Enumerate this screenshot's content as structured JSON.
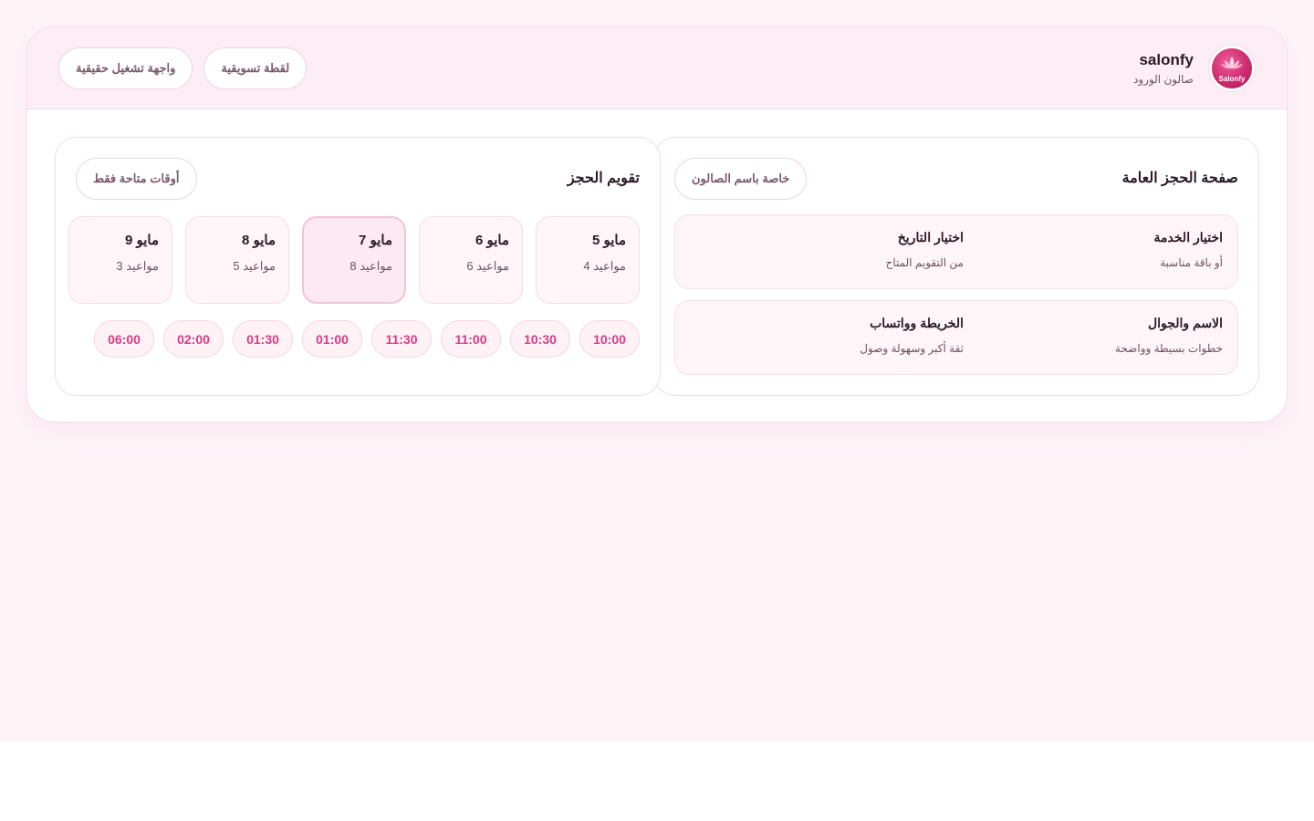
{
  "brand": {
    "name": "salonfy",
    "subtitle": "صالون الورود",
    "logo_text": "Salonfy",
    "logo_icon": "lotus-icon"
  },
  "header": {
    "pills": [
      "واجهة تشغيل حقيقية",
      "لقطة تسويقية"
    ]
  },
  "booking_page": {
    "title": "صفحة الحجز العامة",
    "badge": "خاصة باسم الصالون",
    "features": [
      {
        "title": "اختيار الخدمة",
        "subtitle": "أو باقة مناسبة"
      },
      {
        "title": "اختيار التاريخ",
        "subtitle": "من التقويم المتاح"
      },
      {
        "title": "الاسم والجوال",
        "subtitle": "خطوات بسيطة وواضحة"
      },
      {
        "title": "الخريطة وواتساب",
        "subtitle": "ثقة أكبر وسهولة وصول"
      }
    ]
  },
  "calendar": {
    "title": "تقويم الحجز",
    "badge": "أوقات متاحة فقط",
    "days": [
      {
        "date": "5 مايو",
        "count": "4 مواعيد",
        "selected": false
      },
      {
        "date": "6 مايو",
        "count": "6 مواعيد",
        "selected": false
      },
      {
        "date": "7 مايو",
        "count": "8 مواعيد",
        "selected": true
      },
      {
        "date": "8 مايو",
        "count": "5 مواعيد",
        "selected": false
      },
      {
        "date": "9 مايو",
        "count": "3 مواعيد",
        "selected": false
      }
    ],
    "times": [
      "10:00",
      "10:30",
      "11:00",
      "11:30",
      "01:00",
      "01:30",
      "02:00",
      "06:00"
    ]
  },
  "colors": {
    "accent": "#d63c84",
    "header_bg": "#fdeef5",
    "page_bg": "#fef4f8"
  }
}
